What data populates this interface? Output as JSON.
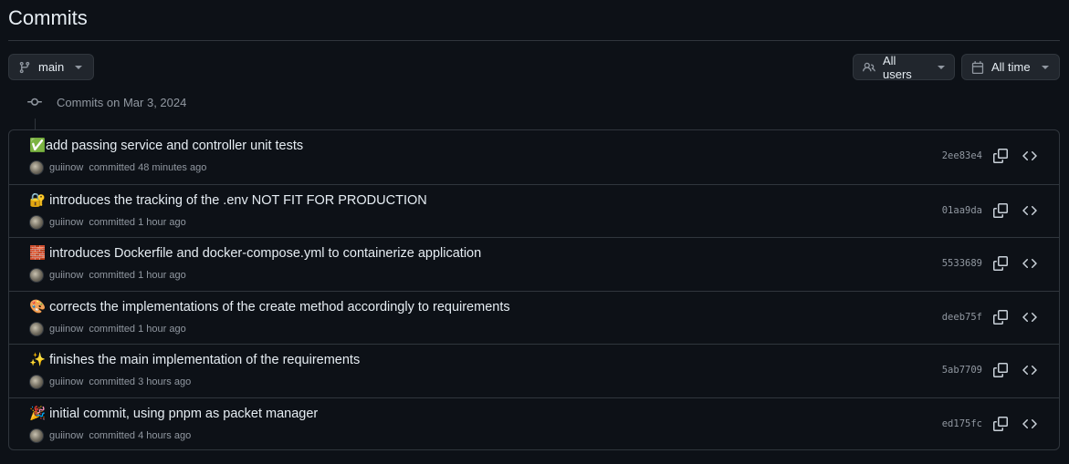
{
  "page": {
    "title": "Commits"
  },
  "filters": {
    "branch": {
      "label": "main",
      "icon": "branch-icon"
    },
    "users": {
      "label": "All users",
      "icon": "people-icon"
    },
    "time": {
      "label": "All time",
      "icon": "calendar-icon"
    }
  },
  "timeline": {
    "heading": "Commits on Mar 3, 2024",
    "icon": "git-commit-icon"
  },
  "commits": [
    {
      "message": "✅add passing service and controller unit tests",
      "author": "guiinow",
      "time": "committed 48 minutes ago",
      "sha": "2ee83e4"
    },
    {
      "message": "🔐 introduces the tracking of the .env NOT FIT FOR PRODUCTION",
      "author": "guiinow",
      "time": "committed 1 hour ago",
      "sha": "01aa9da"
    },
    {
      "message": "🧱 introduces Dockerfile and docker-compose.yml to containerize application",
      "author": "guiinow",
      "time": "committed 1 hour ago",
      "sha": "5533689"
    },
    {
      "message": "🎨 corrects the implementations of the create method accordingly to requirements",
      "author": "guiinow",
      "time": "committed 1 hour ago",
      "sha": "deeb75f"
    },
    {
      "message": "✨ finishes the main implementation of the requirements",
      "author": "guiinow",
      "time": "committed 3 hours ago",
      "sha": "5ab7709"
    },
    {
      "message": "🎉 initial commit, using pnpm as packet manager",
      "author": "guiinow",
      "time": "committed 4 hours ago",
      "sha": "ed175fc"
    }
  ],
  "colors": {
    "background": "#0d1117",
    "border": "#30363d",
    "muted": "#9198a1",
    "text": "#e6edf3"
  }
}
